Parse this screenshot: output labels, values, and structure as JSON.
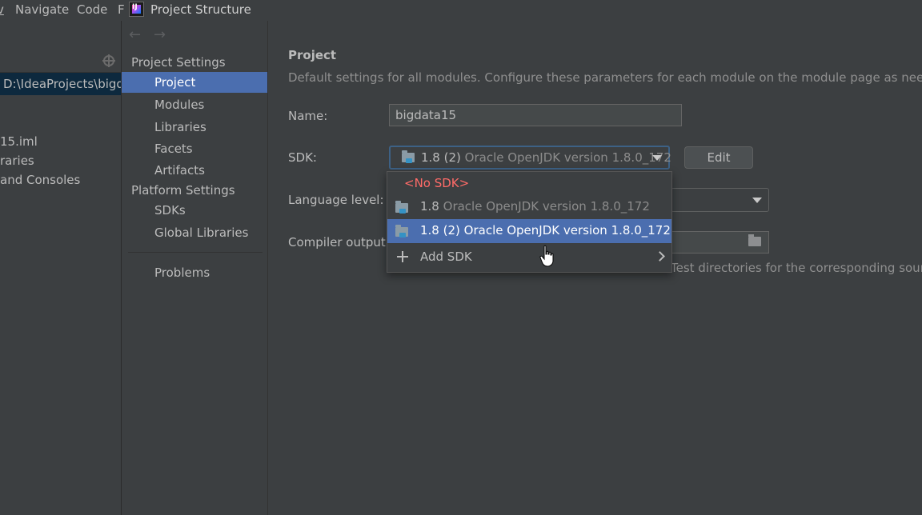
{
  "menu": {
    "items": [
      {
        "text": "v"
      },
      {
        "text": "Navigate"
      },
      {
        "text": "Code"
      },
      {
        "text": "F"
      }
    ]
  },
  "window": {
    "title": "Project Structure"
  },
  "background_panel": {
    "selected_path": "D:\\IdeaProjects\\bigda",
    "items": [
      "15.iml",
      "raries",
      "and Consoles"
    ]
  },
  "sidebar": {
    "project_settings_header": "Project Settings",
    "project_settings_items": [
      "Project",
      "Modules",
      "Libraries",
      "Facets",
      "Artifacts"
    ],
    "platform_settings_header": "Platform Settings",
    "platform_settings_items": [
      "SDKs",
      "Global Libraries"
    ],
    "problems": "Problems",
    "selected": "Project"
  },
  "content": {
    "title": "Project",
    "description": "Default settings for all modules. Configure these parameters for each module on the module page as needed.",
    "name_label": "Name:",
    "name_value": "bigdata15",
    "sdk_label": "SDK:",
    "sdk_value_version": "1.8 (2)",
    "sdk_value_detail": "Oracle OpenJDK version 1.8.0_172",
    "edit_button": "Edit",
    "language_level_label": "Language level:",
    "compiler_output_label": "Compiler output:",
    "hint_text": "Test directories for the corresponding source"
  },
  "sdk_dropdown": {
    "no_sdk": "<No SDK>",
    "items": [
      {
        "version": "1.8",
        "detail": "Oracle OpenJDK version 1.8.0_172",
        "selected": false
      },
      {
        "version": "1.8 (2)",
        "detail": "Oracle OpenJDK version 1.8.0_172",
        "selected": true
      }
    ],
    "add_sdk": "Add SDK"
  },
  "icons": {
    "app": "intellij-logo-icon",
    "back": "arrow-left-icon",
    "forward": "arrow-right-icon",
    "locate": "locate-crosshair-icon",
    "sdk": "folder-sdk-icon",
    "add": "plus-icon",
    "submenu": "chevron-right-icon",
    "browse": "folder-open-icon",
    "cursor": "hand-pointer-icon"
  },
  "colors": {
    "background": "#3c3f41",
    "selection": "#4b6eaf",
    "error_text": "#ff6b68",
    "focus_border": "#3d6185"
  }
}
